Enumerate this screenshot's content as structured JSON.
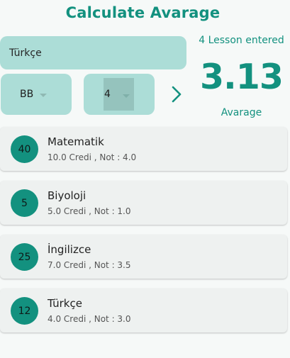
{
  "header": {
    "title": "Calculate Avarage"
  },
  "form": {
    "lesson_name": "Türkçe",
    "grade": "BB",
    "credit": "4"
  },
  "summary": {
    "lesson_count_text": "4 Lesson entered",
    "average": "3.13",
    "average_label": "Avarage"
  },
  "colors": {
    "accent": "#13917f",
    "field_bg": "#acddd7"
  },
  "lessons": [
    {
      "score": "40",
      "name": "Matematik",
      "details": "10.0 Credi , Not : 4.0"
    },
    {
      "score": "5",
      "name": "Biyoloji",
      "details": "5.0 Credi , Not : 1.0"
    },
    {
      "score": "25",
      "name": "İngilizce",
      "details": "7.0 Credi , Not : 3.5"
    },
    {
      "score": "12",
      "name": "Türkçe",
      "details": "4.0 Credi , Not : 3.0"
    }
  ]
}
